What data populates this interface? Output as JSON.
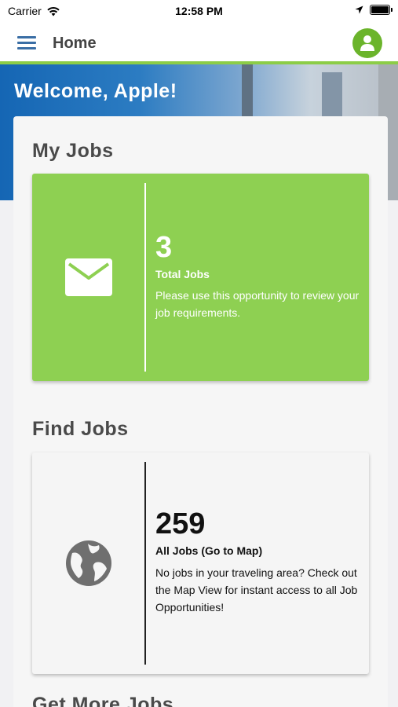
{
  "status_bar": {
    "carrier": "Carrier",
    "time": "12:58 PM"
  },
  "app_bar": {
    "title": "Home"
  },
  "hero": {
    "welcome": "Welcome, Apple!"
  },
  "sections": {
    "my_jobs": {
      "title": "My Jobs",
      "count": "3",
      "label": "Total Jobs",
      "description": "Please use this opportunity to review your job requirements.",
      "icon": "mail-icon",
      "color": "#8ed052"
    },
    "find_jobs": {
      "title": "Find Jobs",
      "count": "259",
      "label": "All Jobs (Go to Map)",
      "description": "No jobs in your traveling area? Check out the Map View for instant access to all Job Opportunities!",
      "icon": "globe-icon"
    },
    "get_more_jobs": {
      "title": "Get More Jobs"
    }
  },
  "colors": {
    "accent_green": "#8ccd47",
    "avatar_green": "#6bb42b",
    "menu_blue": "#3a6ea5"
  }
}
